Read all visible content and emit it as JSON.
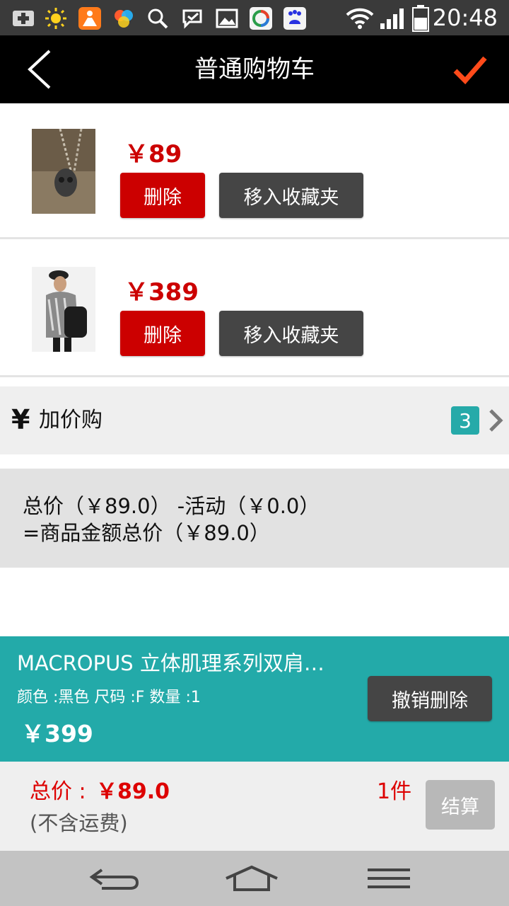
{
  "status_bar": {
    "time": "20:48",
    "icons": [
      "plus-icon",
      "sun-icon",
      "app-icon",
      "color-icon",
      "search-icon",
      "message-icon",
      "image-icon",
      "browser-icon",
      "baidu-icon",
      "wifi-icon",
      "signal-icon",
      "battery-icon"
    ]
  },
  "header": {
    "title": "普通购物车"
  },
  "items": [
    {
      "price": "￥89",
      "delete_label": "删除",
      "favorite_label": "移入收藏夹"
    },
    {
      "price": "￥389",
      "delete_label": "删除",
      "favorite_label": "移入收藏夹"
    }
  ],
  "add_price_buy": {
    "icon": "¥",
    "label": "加价购",
    "badge": "3"
  },
  "summary": {
    "line1": "总价（￥89.0） -活动（￥0.0）",
    "line2": "=商品金额总价（￥89.0）"
  },
  "removed_item": {
    "name": "MACROPUS 立体肌理系列双肩…",
    "spec": "颜色 :黑色  尺码 :F  数量 :1",
    "price": "￥399",
    "undo_label": "撤销删除"
  },
  "total_bar": {
    "total_label": "总价 :",
    "total_value": "￥89.0",
    "shipping_note": "(不含运费)",
    "count": "1件",
    "checkout_label": "结算"
  },
  "colors": {
    "accent_red": "#cc0000",
    "teal": "#23aaa9",
    "dark_button": "#454545",
    "confirm_orange": "#ff4a1a"
  }
}
